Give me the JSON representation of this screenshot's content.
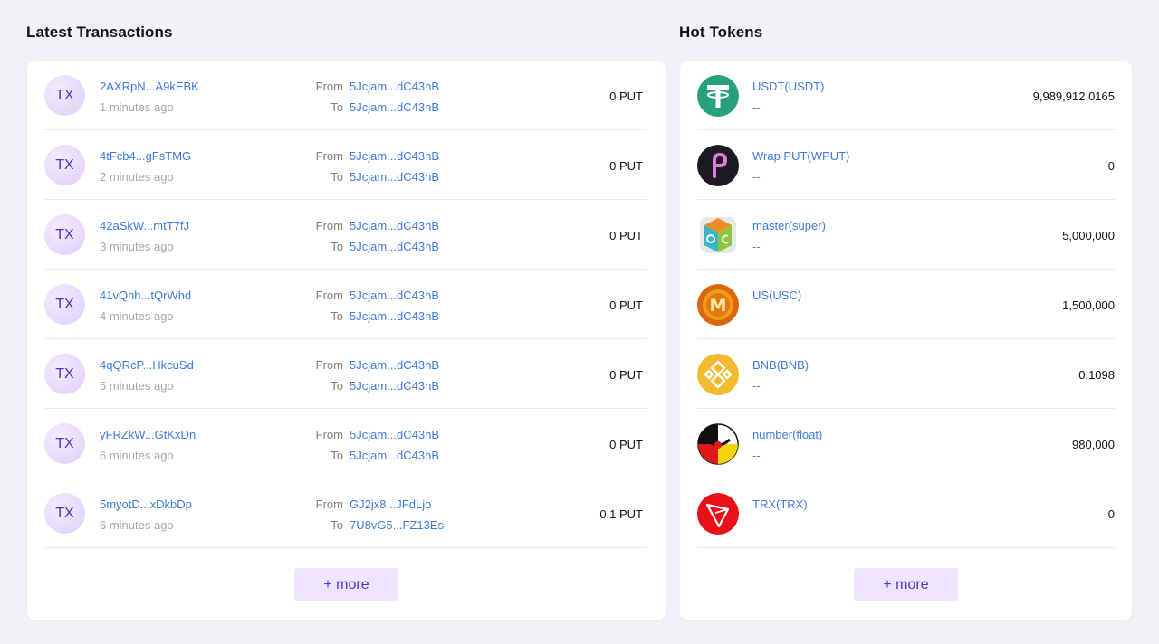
{
  "transactions": {
    "title": "Latest Transactions",
    "badge": "TX",
    "from_label": "From",
    "to_label": "To",
    "rows": [
      {
        "hash": "2AXRpN...A9kEBK",
        "age": "1 minutes ago",
        "from": "5Jcjam...dC43hB",
        "to": "5Jcjam...dC43hB",
        "amount": "0 PUT"
      },
      {
        "hash": "4tFcb4...gFsTMG",
        "age": "2 minutes ago",
        "from": "5Jcjam...dC43hB",
        "to": "5Jcjam...dC43hB",
        "amount": "0 PUT"
      },
      {
        "hash": "42aSkW...mtT7fJ",
        "age": "3 minutes ago",
        "from": "5Jcjam...dC43hB",
        "to": "5Jcjam...dC43hB",
        "amount": "0 PUT"
      },
      {
        "hash": "41vQhh...tQrWhd",
        "age": "4 minutes ago",
        "from": "5Jcjam...dC43hB",
        "to": "5Jcjam...dC43hB",
        "amount": "0 PUT"
      },
      {
        "hash": "4qQRcP...HkcuSd",
        "age": "5 minutes ago",
        "from": "5Jcjam...dC43hB",
        "to": "5Jcjam...dC43hB",
        "amount": "0 PUT"
      },
      {
        "hash": "yFRZkW...GtKxDn",
        "age": "6 minutes ago",
        "from": "5Jcjam...dC43hB",
        "to": "5Jcjam...dC43hB",
        "amount": "0 PUT"
      },
      {
        "hash": "5myotD...xDkbDp",
        "age": "6 minutes ago",
        "from": "GJ2jx8...JFdLjo",
        "to": "7U8vG5...FZ13Es",
        "amount": "0.1 PUT"
      }
    ],
    "more_label": "+ more"
  },
  "tokens": {
    "title": "Hot Tokens",
    "rows": [
      {
        "name": "USDT(USDT)",
        "sub": "--",
        "value": "9,989,912.0165",
        "icon": "usdt-icon"
      },
      {
        "name": "Wrap PUT(WPUT)",
        "sub": "--",
        "value": "0",
        "icon": "wput-icon"
      },
      {
        "name": "master(super)",
        "sub": "--",
        "value": "5,000,000",
        "icon": "master-icon"
      },
      {
        "name": "US(USC)",
        "sub": "--",
        "value": "1,500,000",
        "icon": "usc-icon"
      },
      {
        "name": "BNB(BNB)",
        "sub": "--",
        "value": "0.1098",
        "icon": "bnb-icon"
      },
      {
        "name": "number(float)",
        "sub": "--",
        "value": "980,000",
        "icon": "number-icon"
      },
      {
        "name": "TRX(TRX)",
        "sub": "--",
        "value": "0",
        "icon": "trx-icon"
      }
    ],
    "more_label": "+ more"
  },
  "colors": {
    "link": "#3d7ae0",
    "accent": "#5a2fcb",
    "button_bg": "#ece5fc",
    "page_bg": "#f1f2f5"
  }
}
